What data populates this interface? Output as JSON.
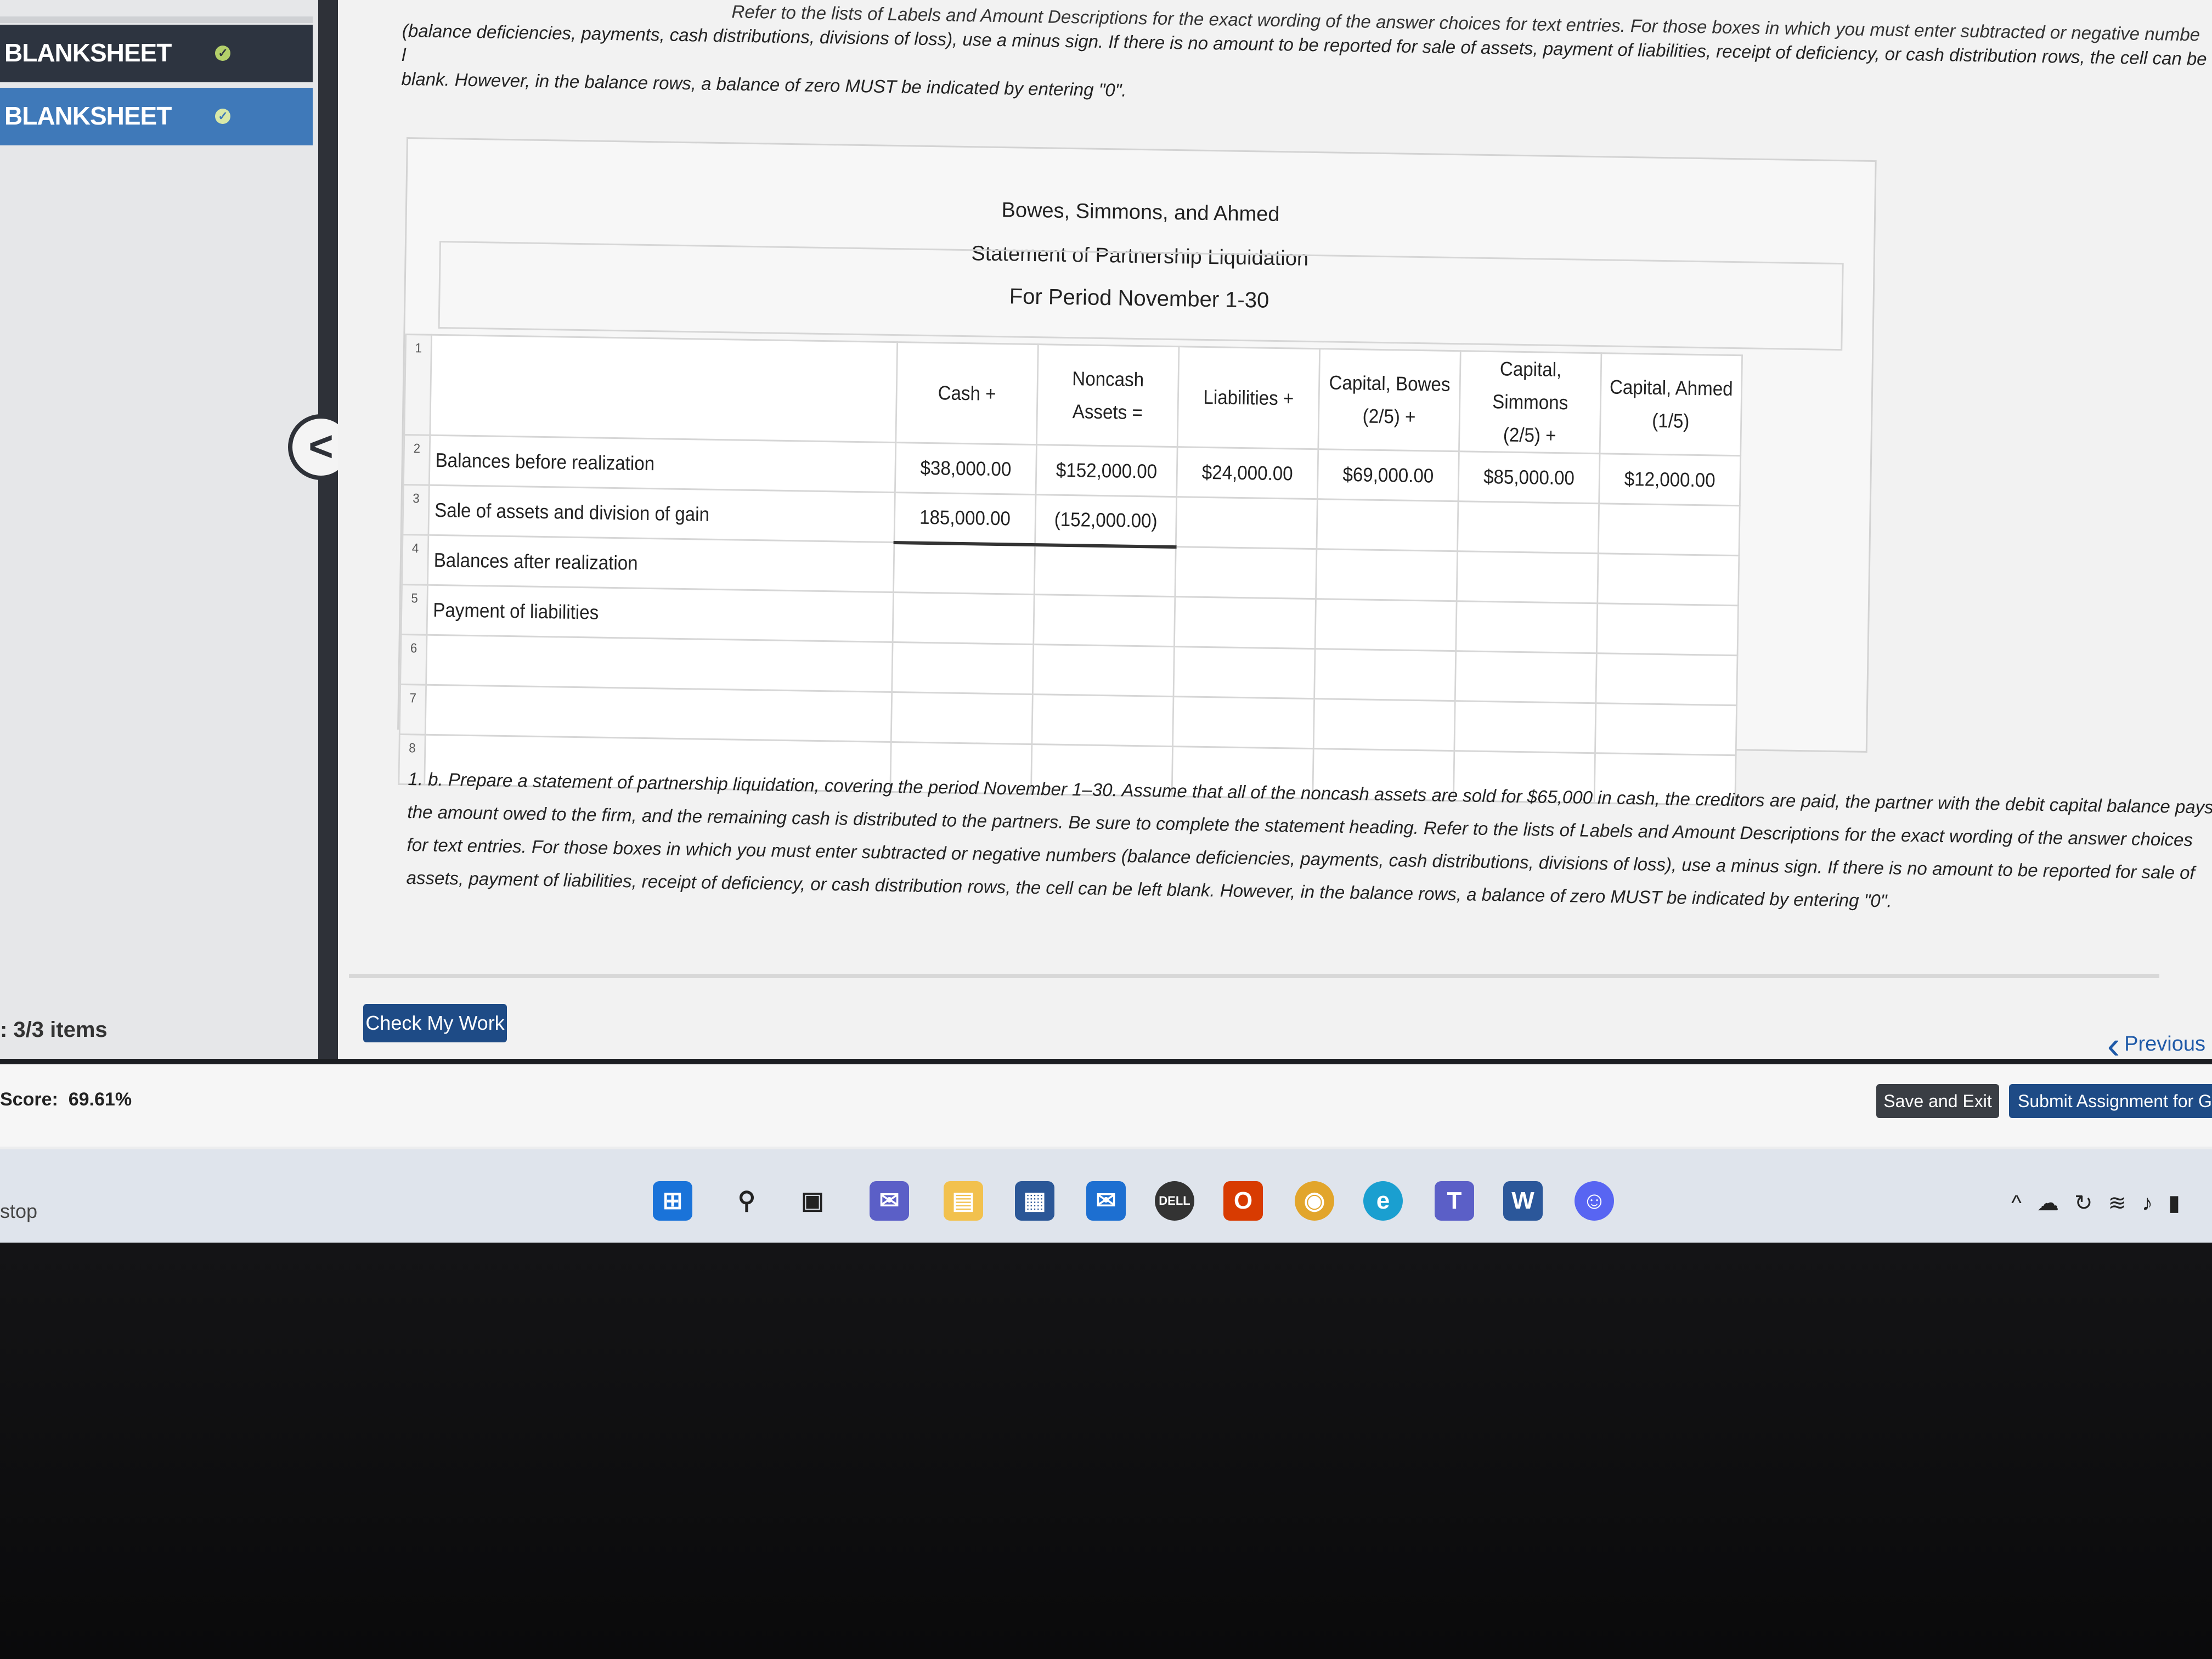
{
  "sidebar": {
    "items": [
      {
        "label": "BLANKSHEET",
        "status": "complete"
      },
      {
        "label": "BLANKSHEET",
        "status": "complete"
      }
    ],
    "items_count": ": 3/3 items"
  },
  "instructions": {
    "top_fragment": "Refer to the lists of Labels and Amount Descriptions for the exact wording of the answer choices for text entries. For those boxes in which you must enter subtracted or negative numbe",
    "line2": "(balance deficiencies, payments, cash distributions, divisions of loss), use a minus sign. If there is no amount to be reported for sale of assets, payment of liabilities, receipt of deficiency, or cash distribution rows, the cell can be l",
    "line3": "blank. However, in the balance rows, a balance of zero MUST be indicated by entering \"0\"."
  },
  "statement": {
    "company": "Bowes, Simmons, and Ahmed",
    "title": "Statement of Partnership Liquidation",
    "period": "For Period November 1-30",
    "columns": [
      {
        "line1": "Cash +",
        "line2": ""
      },
      {
        "line1": "Noncash Assets =",
        "line2": ""
      },
      {
        "line1": "Liabilities +",
        "line2": ""
      },
      {
        "line1": "Capital, Bowes",
        "line2": "(2/5) +"
      },
      {
        "line1": "Capital, Simmons",
        "line2": "(2/5) +"
      },
      {
        "line1": "Capital, Ahmed",
        "line2": "(1/5)"
      }
    ],
    "rows": [
      {
        "num": "1",
        "label": "",
        "values": [
          "",
          "",
          "",
          "",
          "",
          ""
        ]
      },
      {
        "num": "2",
        "label": "Balances before realization",
        "values": [
          "$38,000.00",
          "$152,000.00",
          "$24,000.00",
          "$69,000.00",
          "$85,000.00",
          "$12,000.00"
        ]
      },
      {
        "num": "3",
        "label": "Sale of assets and division of gain",
        "values": [
          "185,000.00",
          "(152,000.00)",
          "",
          "",
          "",
          ""
        ]
      },
      {
        "num": "4",
        "label": "Balances after realization",
        "values": [
          "",
          "",
          "",
          "",
          "",
          ""
        ]
      },
      {
        "num": "5",
        "label": "Payment of liabilities",
        "values": [
          "",
          "",
          "",
          "",
          "",
          ""
        ]
      },
      {
        "num": "6",
        "label": "",
        "values": [
          "",
          "",
          "",
          "",
          "",
          ""
        ]
      },
      {
        "num": "7",
        "label": "",
        "values": [
          "",
          "",
          "",
          "",
          "",
          ""
        ]
      },
      {
        "num": "8",
        "label": "",
        "values": [
          "",
          "",
          "",
          "",
          "",
          ""
        ]
      }
    ]
  },
  "question_b": "1. b. Prepare a statement of partnership liquidation, covering the period November 1–30. Assume that all of the noncash assets are sold for $65,000 in cash, the creditors are paid, the partner with the debit capital balance pays the amount owed to the firm, and the remaining cash is distributed to the partners. Be sure to complete the statement heading. Refer to the lists of Labels and Amount Descriptions for the exact wording of the answer choices for text entries. For those boxes in which you must enter subtracted or negative numbers (balance deficiencies, payments, cash distributions, divisions of loss), use a minus sign. If there is no amount to be reported for sale of assets, payment of liabilities, receipt of deficiency, or cash distribution rows, the cell can be left blank. However, in the balance rows, a balance of zero MUST be indicated by entering \"0\".",
  "buttons": {
    "check_my_work": "Check My Work",
    "previous": "Previous",
    "save_and_exit": "Save and Exit",
    "submit": "Submit Assignment for Gr"
  },
  "score": {
    "label": "Score:",
    "value": "69.61%"
  },
  "taskbar": {
    "left_text": "stop",
    "icons": [
      "windows-start-icon",
      "search-icon",
      "task-view-icon",
      "chat-icon",
      "file-explorer-icon",
      "store-icon",
      "mail-icon",
      "dell-icon",
      "office-icon",
      "chrome-icon",
      "edge-icon",
      "teams-icon",
      "word-icon",
      "discord-icon"
    ]
  },
  "colors": {
    "sidebar_dark": "#2d3440",
    "sidebar_active": "#3f79b9",
    "primary_button": "#1e4b86",
    "save_button": "#3a3e44",
    "link": "#1f5aa8"
  }
}
